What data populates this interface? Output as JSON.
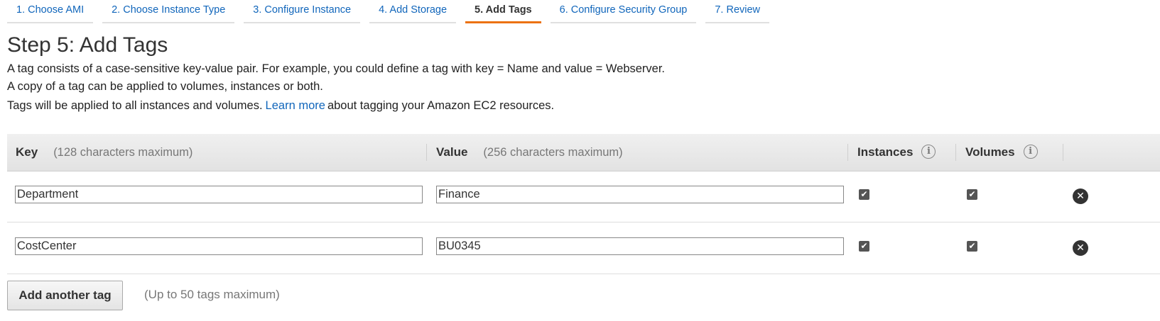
{
  "wizard": {
    "steps": [
      {
        "label": "1. Choose AMI"
      },
      {
        "label": "2. Choose Instance Type"
      },
      {
        "label": "3. Configure Instance"
      },
      {
        "label": "4. Add Storage"
      },
      {
        "label": "5. Add Tags"
      },
      {
        "label": "6. Configure Security Group"
      },
      {
        "label": "7. Review"
      }
    ],
    "active_index": 4,
    "active_color": "#ec7211",
    "link_color": "#1166bb"
  },
  "page": {
    "title": "Step 5: Add Tags",
    "desc_line1": "A tag consists of a case-sensitive key-value pair. For example, you could define a tag with key = Name and value = Webserver.",
    "desc_line2": "A copy of a tag can be applied to volumes, instances or both.",
    "desc_line3_pre": "Tags will be applied to all instances and volumes.",
    "learn_more": "Learn more",
    "desc_line3_post": "about tagging your Amazon EC2 resources."
  },
  "table": {
    "headers": {
      "key": "Key",
      "key_hint": "(128 characters maximum)",
      "value": "Value",
      "value_hint": "(256 characters maximum)",
      "instances": "Instances",
      "volumes": "Volumes",
      "info_icon": "i"
    },
    "rows": [
      {
        "key": "Department",
        "value": "Finance",
        "instances": true,
        "volumes": true
      },
      {
        "key": "CostCenter",
        "value": "BU0345",
        "instances": true,
        "volumes": true
      }
    ]
  },
  "footer": {
    "add_button": "Add another tag",
    "limit_text": "(Up to 50 tags maximum)"
  },
  "icons": {
    "check": "check-icon",
    "remove": "remove-icon",
    "info": "info-icon"
  }
}
